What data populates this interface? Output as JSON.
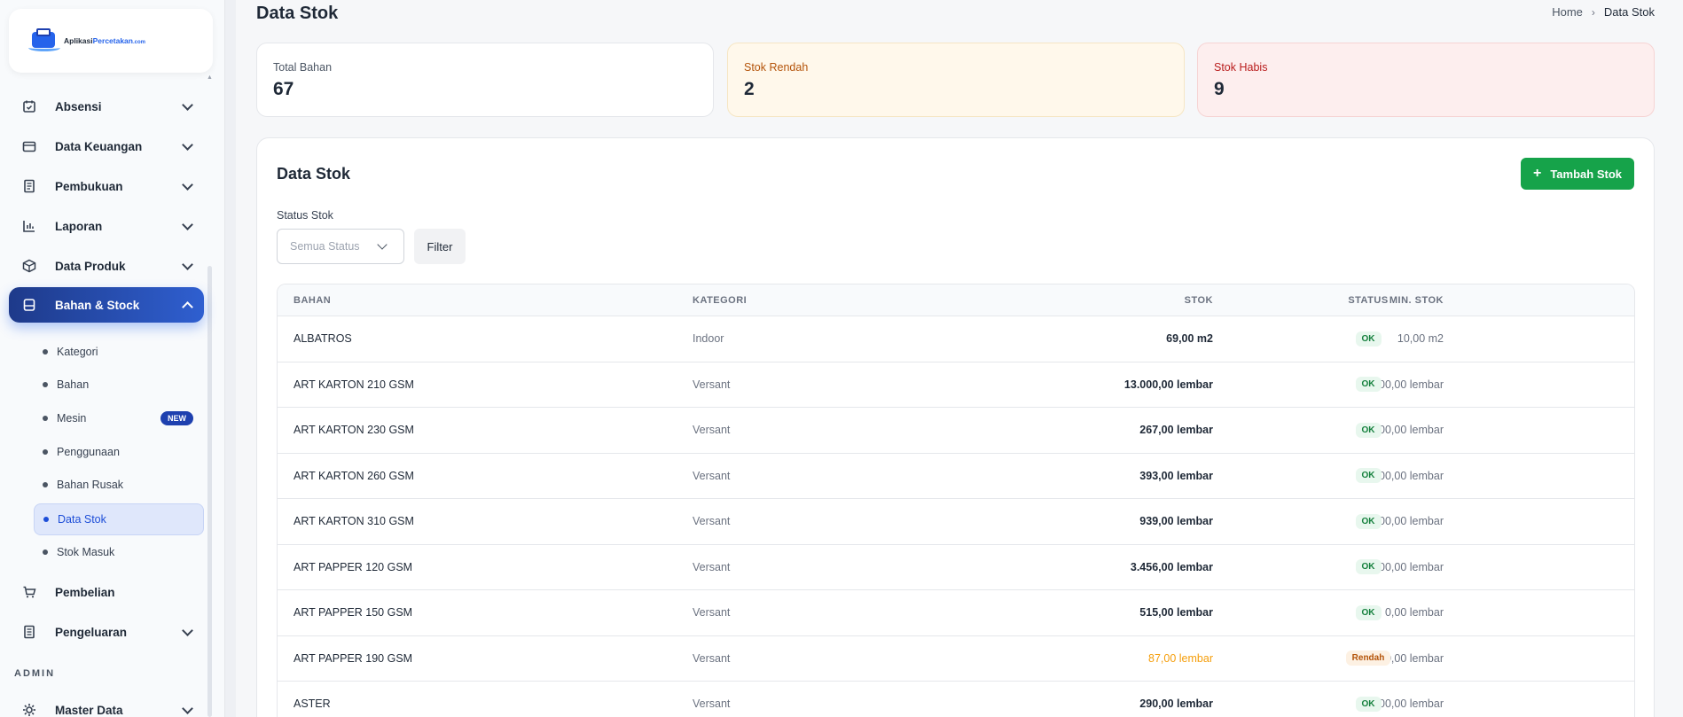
{
  "logo": {
    "part1": "Aplikasi",
    "part2": "Percetakan",
    "part3": ".com"
  },
  "sidebar": {
    "items": [
      {
        "label": "Absensi",
        "icon": "calendar-check-icon"
      },
      {
        "label": "Data Keuangan",
        "icon": "wallet-icon"
      },
      {
        "label": "Pembukuan",
        "icon": "book-icon"
      },
      {
        "label": "Laporan",
        "icon": "bar-chart-icon"
      },
      {
        "label": "Data Produk",
        "icon": "box-icon"
      },
      {
        "label": "Bahan & Stock",
        "icon": "database-icon"
      }
    ],
    "subitems": [
      "Kategori",
      "Bahan",
      "Mesin",
      "Penggunaan",
      "Bahan Rusak",
      "Data Stok",
      "Stok Masuk"
    ],
    "new_badge": "NEW",
    "after_items": [
      {
        "label": "Pembelian",
        "icon": "cart-icon"
      },
      {
        "label": "Pengeluaran",
        "icon": "receipt-icon"
      }
    ],
    "section_admin": "ADMIN",
    "master": {
      "label": "Master Data",
      "icon": "gear-icon"
    }
  },
  "header": {
    "title": "Data Stok",
    "breadcrumb": [
      "Home",
      "Data Stok"
    ]
  },
  "stats": {
    "total_label": "Total Bahan",
    "total_value": "67",
    "low_label": "Stok Rendah",
    "low_value": "2",
    "out_label": "Stok Habis",
    "out_value": "9"
  },
  "panel": {
    "title": "Data Stok",
    "add_button": "Tambah Stok",
    "filter_label": "Status Stok",
    "select_placeholder": "Semua Status",
    "filter_button": "Filter"
  },
  "table": {
    "headers": [
      "BAHAN",
      "KATEGORI",
      "STOK",
      "MIN. STOK",
      "STATUS"
    ],
    "rows": [
      {
        "bahan": "ALBATROS",
        "kategori": "Indoor",
        "stok": "69,00 m2",
        "min": "10,00 m2",
        "status": "OK"
      },
      {
        "bahan": "ART KARTON 210 GSM",
        "kategori": "Versant",
        "stok": "13.000,00 lembar",
        "min": "100,00 lembar",
        "status": "OK"
      },
      {
        "bahan": "ART KARTON 230 GSM",
        "kategori": "Versant",
        "stok": "267,00 lembar",
        "min": "100,00 lembar",
        "status": "OK"
      },
      {
        "bahan": "ART KARTON 260 GSM",
        "kategori": "Versant",
        "stok": "393,00 lembar",
        "min": "100,00 lembar",
        "status": "OK"
      },
      {
        "bahan": "ART KARTON 310 GSM",
        "kategori": "Versant",
        "stok": "939,00 lembar",
        "min": "100,00 lembar",
        "status": "OK"
      },
      {
        "bahan": "ART PAPPER 120 GSM",
        "kategori": "Versant",
        "stok": "3.456,00 lembar",
        "min": "100,00 lembar",
        "status": "OK"
      },
      {
        "bahan": "ART PAPPER 150 GSM",
        "kategori": "Versant",
        "stok": "515,00 lembar",
        "min": "0,00 lembar",
        "status": "OK"
      },
      {
        "bahan": "ART PAPPER 190 GSM",
        "kategori": "Versant",
        "stok": "87,00 lembar",
        "min": "100,00 lembar",
        "status": "Rendah"
      },
      {
        "bahan": "ASTER",
        "kategori": "Versant",
        "stok": "290,00 lembar",
        "min": "100,00 lembar",
        "status": "OK"
      }
    ]
  },
  "colors": {
    "primary": "#1e40af",
    "success": "#16a34a",
    "warning": "#f59e0b",
    "danger": "#b91c1c"
  }
}
